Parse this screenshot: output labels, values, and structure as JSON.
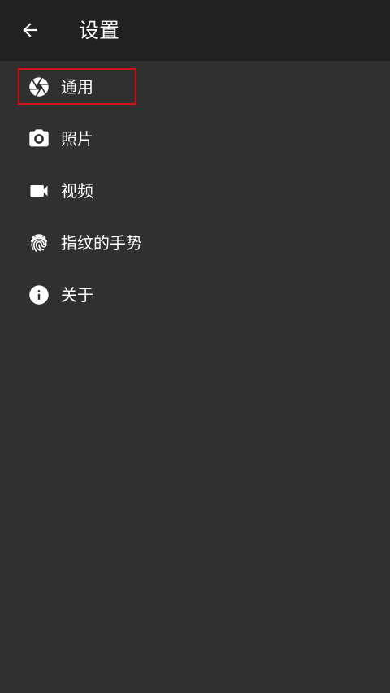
{
  "header": {
    "title": "设置",
    "back_icon": "arrow-back-icon"
  },
  "menu": {
    "items": [
      {
        "label": "通用",
        "icon": "aperture-icon",
        "highlighted": true
      },
      {
        "label": "照片",
        "icon": "camera-icon",
        "highlighted": false
      },
      {
        "label": "视频",
        "icon": "videocam-icon",
        "highlighted": false
      },
      {
        "label": "指纹的手势",
        "icon": "fingerprint-icon",
        "highlighted": false
      },
      {
        "label": "关于",
        "icon": "info-icon",
        "highlighted": false
      }
    ]
  },
  "colors": {
    "app_bar": "#212121",
    "background": "#303030",
    "text": "#ffffff",
    "highlight_border": "#d0141c"
  }
}
